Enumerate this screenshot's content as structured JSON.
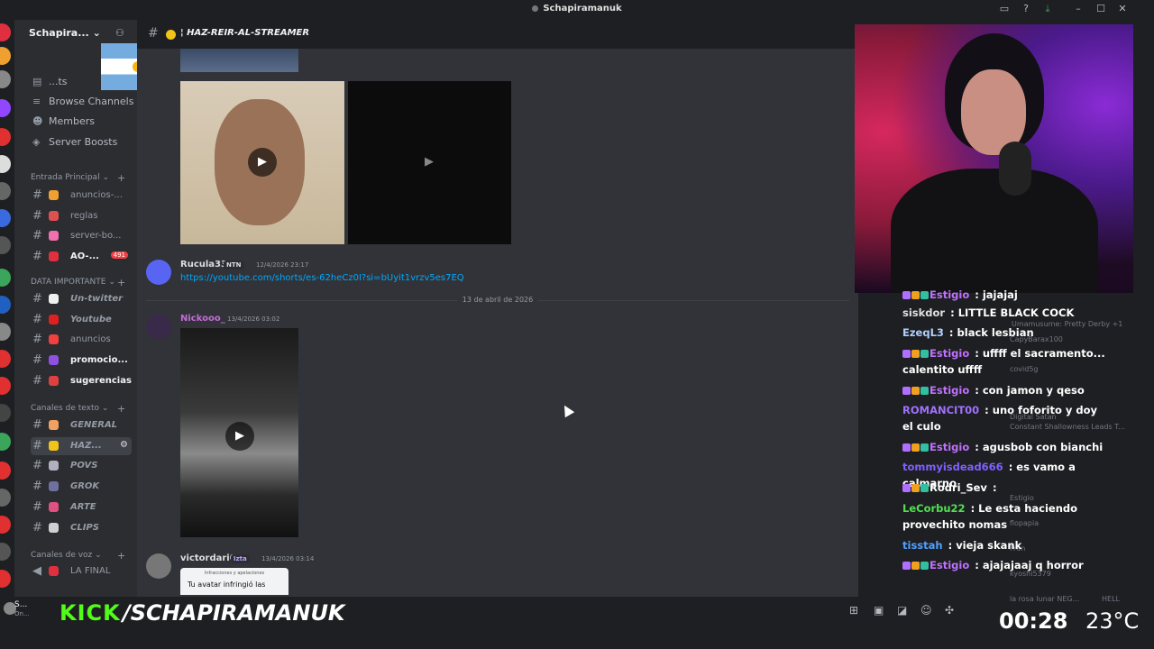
{
  "window": {
    "title": "Schapiramanuk"
  },
  "server": {
    "name": "Schapira...",
    "nav": {
      "events": "...ts",
      "browse": "Browse Channels",
      "members": "Members",
      "boosts": "Server Boosts"
    }
  },
  "categories": {
    "entrada": "Entrada Principal",
    "data": "DATA IMPORTANTE",
    "texto": "Canales de texto",
    "voz": "Canales de voz"
  },
  "channels": {
    "entrada": [
      {
        "name": "anuncios-...",
        "emoji_color": "#f0a030"
      },
      {
        "name": "reglas",
        "emoji_color": "#e05050"
      },
      {
        "name": "server-bo...",
        "emoji_color": "#f070b0"
      },
      {
        "name": "AO-...",
        "emoji_color": "#e03040",
        "badge": "491"
      }
    ],
    "data": [
      {
        "name": "Un-twitter",
        "emoji_color": "#f0f0f0"
      },
      {
        "name": "Youtube",
        "emoji_color": "#e02020"
      },
      {
        "name": "anuncios",
        "emoji_color": "#f04040"
      },
      {
        "name": "promocio...",
        "emoji_color": "#9050e0"
      },
      {
        "name": "sugerencias",
        "emoji_color": "#e04040"
      }
    ],
    "texto": [
      {
        "name": "GENERAL",
        "emoji_color": "#f0a060"
      },
      {
        "name": "HAZ...",
        "emoji_color": "#f0c419"
      },
      {
        "name": "POVS",
        "emoji_color": "#b0b0c0"
      },
      {
        "name": "GROK",
        "emoji_color": "#7070a0"
      },
      {
        "name": "ARTE",
        "emoji_color": "#e05080"
      },
      {
        "name": "CLIPS",
        "emoji_color": "#d0d0d0"
      }
    ],
    "voz": [
      {
        "name": "LA FINAL",
        "emoji_color": "#e03040"
      }
    ]
  },
  "header": {
    "channel": "HAZ-REIR-AL-STREAMER"
  },
  "messages": [
    {
      "user": "Rucula33",
      "color": "#f2f3f5",
      "tag": "NTN",
      "time": "12/4/2026 23:17",
      "link": "https://youtube.com/shorts/es-62heCz0I?si=bUyit1vrzv5es7EQ"
    },
    {
      "user": "Nickooo_",
      "color": "#c46bd8",
      "time": "13/4/2026 03:02"
    },
    {
      "user": "victordari0",
      "color": "#f2f3f5",
      "tag": "Izta",
      "time": "13/4/2026 03:14",
      "embed_title": "Infracciones y apelaciones",
      "embed_text": "Tu avatar infringió las"
    }
  ],
  "date_divider": "13 de abril de 2026",
  "stream": {
    "kick_label": "KICK",
    "handle": "/SCHAPIRAMANUK",
    "timer": "00:28",
    "temperature": "23°C"
  },
  "chat": [
    {
      "user": "Estigio",
      "color": "#c070ff",
      "text": "jajajaj",
      "badges": true
    },
    {
      "user": "siskdor",
      "color": "#e0e0e0",
      "text": "LITTLE BLACK COCK"
    },
    {
      "user": "EzeqL3",
      "color": "#b0d0ff",
      "text": "black lesbian"
    },
    {
      "user": "Estigio",
      "color": "#c070ff",
      "text": "uffff el sacramento... calentito uffff",
      "badges": true
    },
    {
      "user": "Estigio",
      "color": "#c070ff",
      "text": "con jamon y qeso",
      "badges": true
    },
    {
      "user": "ROMANCIT00",
      "color": "#a070ff",
      "text": "uno foforito y doy el culo"
    },
    {
      "user": "Estigio",
      "color": "#c070ff",
      "text": "agusbob con bianchi",
      "badges": true
    },
    {
      "user": "tommyisdead666",
      "color": "#8060ff",
      "text": "es vamo a calmarno"
    },
    {
      "user": "Rodri_Sev",
      "color": "#ffffff",
      "text": "",
      "badges": true
    },
    {
      "user": "LeCorbu22",
      "color": "#50e050",
      "text": "Le esta haciendo provechito nomas"
    },
    {
      "user": "tisstah",
      "color": "#50a0ff",
      "text": "vieja skank"
    },
    {
      "user": "Estigio",
      "color": "#c070ff",
      "text": "ajajajaaj q horror",
      "badges": true
    }
  ],
  "ghost_members": [
    "Umamusume: Pretty Derby +1",
    "CapyBarax100",
    "covid5g",
    "Digital Satan",
    "Constant Shallowness Leads T...",
    "Estigio",
    "flopapia",
    "Fran",
    "kyoshi5379",
    "la rosa lunar NEG...",
    "HELL"
  ],
  "colors": {
    "kick_green": "#53fc18",
    "discord_bg": "#313338",
    "sidebar": "#2b2d31"
  }
}
